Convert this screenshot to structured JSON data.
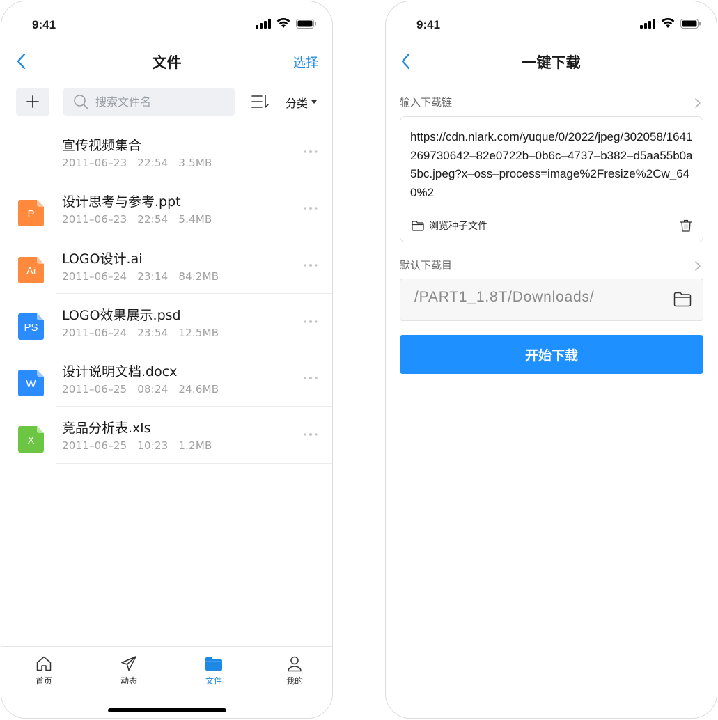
{
  "colors": {
    "accent": "#1e88e5",
    "primary_button": "#1e90ff",
    "ppt": "#ff8a3d",
    "ai": "#ff8a3d",
    "psd": "#2b8cff",
    "docx": "#2b8cff",
    "xls": "#6cc644"
  },
  "left_screen": {
    "status_time": "9:41",
    "nav": {
      "title": "文件",
      "action": "选择"
    },
    "search": {
      "placeholder": "搜索文件名"
    },
    "filter_label": "分类",
    "files": [
      {
        "name": "宣传视频集合",
        "date": "2011–06–23",
        "time": "22:54",
        "size": "3.5MB",
        "icon": "none",
        "icon_letter": ""
      },
      {
        "name": "设计思考与参考.ppt",
        "date": "2011–06–23",
        "time": "22:54",
        "size": "5.4MB",
        "icon": "ppt-file-icon",
        "icon_letter": "P"
      },
      {
        "name": "LOGO设计.ai",
        "date": "2011–06–24",
        "time": "23:14",
        "size": "84.2MB",
        "icon": "ai-file-icon",
        "icon_letter": "Ai"
      },
      {
        "name": "LOGO效果展示.psd",
        "date": "2011–06–24",
        "time": "23:54",
        "size": "12.5MB",
        "icon": "psd-file-icon",
        "icon_letter": "PS"
      },
      {
        "name": "设计说明文档.docx",
        "date": "2011–06–25",
        "time": "08:24",
        "size": "24.6MB",
        "icon": "docx-file-icon",
        "icon_letter": "W"
      },
      {
        "name": "竞品分析表.xls",
        "date": "2011–06–25",
        "time": "10:23",
        "size": "1.2MB",
        "icon": "xls-file-icon",
        "icon_letter": "X"
      }
    ],
    "tabs": [
      {
        "label": "首页",
        "icon": "home-icon",
        "active": false
      },
      {
        "label": "动态",
        "icon": "paper-plane-icon",
        "active": false
      },
      {
        "label": "文件",
        "icon": "folder-icon",
        "active": true
      },
      {
        "label": "我的",
        "icon": "user-icon",
        "active": false
      }
    ]
  },
  "right_screen": {
    "status_time": "9:41",
    "nav": {
      "title": "一键下载"
    },
    "link_section_label": "输入下载链",
    "link_value": "https://cdn.nlark.com/yuque/0/2022/jpeg/302058/1641269730642–82e0722b–0b6c–4737–b382–d5aa55b0a5bc.jpeg?x–oss–process=image%2Fresize%2Cw_640%2",
    "browse_seed_label": "浏览种子文件",
    "dir_section_label": "默认下载目",
    "dir_value": "/PART1_1.8T/Downloads/",
    "start_button": "开始下载"
  }
}
